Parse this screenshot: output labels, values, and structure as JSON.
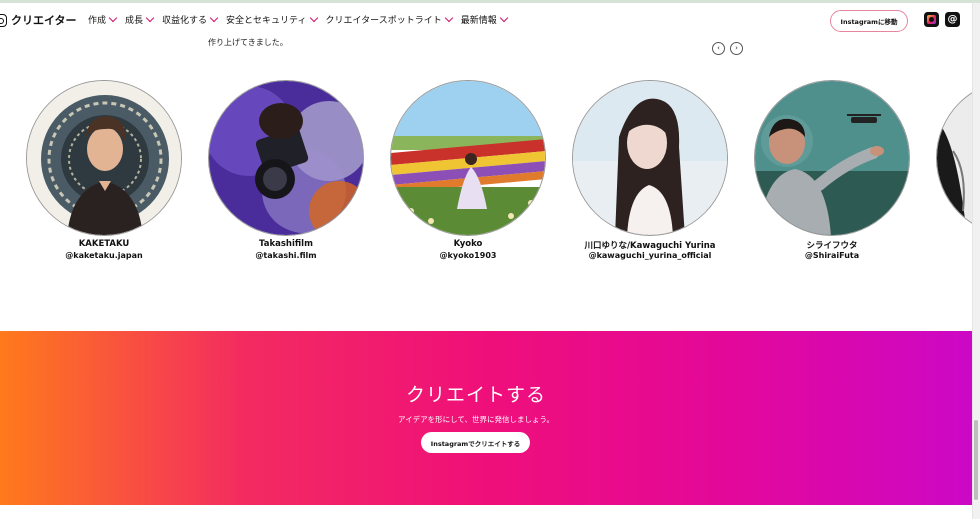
{
  "header": {
    "brand_name": "クリエイター",
    "nav": [
      {
        "label": "作成"
      },
      {
        "label": "成長"
      },
      {
        "label": "収益化する"
      },
      {
        "label": "安全とセキュリティ"
      },
      {
        "label": "クリエイタースポットライト"
      },
      {
        "label": "最新情報"
      }
    ],
    "instagram_button": "Instagramに移動",
    "icons": [
      "instagram-app-icon",
      "threads-app-icon"
    ]
  },
  "intro": {
    "text": "作り上げてきました。",
    "prev_icon": "‹",
    "next_icon": "›"
  },
  "creators": [
    {
      "name": "KAKETAKU",
      "handle": "@kaketaku.japan"
    },
    {
      "name": "Takashifilm",
      "handle": "@takashi.film"
    },
    {
      "name": "Kyoko",
      "handle": "@kyoko1903"
    },
    {
      "name": "川口ゆりな/Kawaguchi Yurina",
      "handle": "@kawaguchi_yurina_official"
    },
    {
      "name": "シライフウタ",
      "handle": "@ShiraiFuta"
    }
  ],
  "cta": {
    "title": "クリエイトする",
    "subtitle": "アイデアを形にして、世界に発信しましょう。",
    "button": "Instagramでクリエイトする"
  },
  "colors": {
    "accent": "#d0116a",
    "gradient": [
      "#ff7a1c",
      "#ef0f7a",
      "#cc08c6"
    ]
  }
}
